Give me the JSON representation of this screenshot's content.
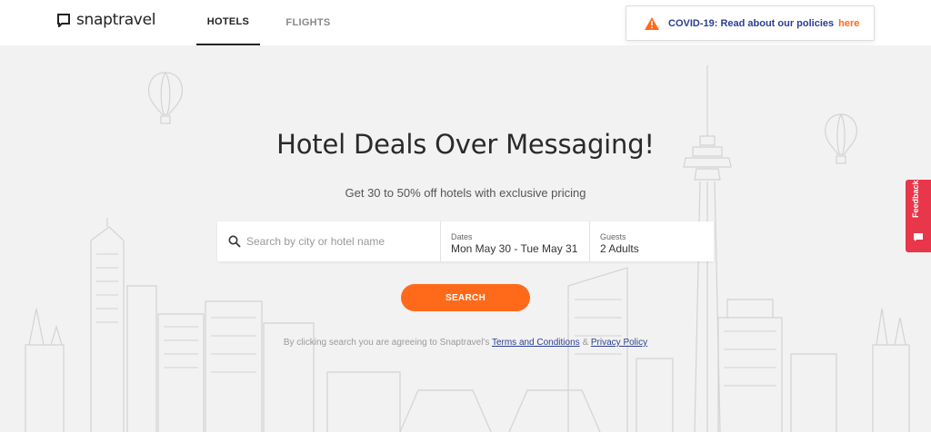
{
  "header": {
    "logo_text": "snaptravel",
    "tabs": [
      {
        "label": "HOTELS",
        "active": true
      },
      {
        "label": "FLIGHTS",
        "active": false
      }
    ]
  },
  "covid_banner": {
    "message": "COVID-19: Read about our policies",
    "link": "here",
    "icon": "warning-icon"
  },
  "hero": {
    "title": "Hotel Deals Over Messaging!",
    "subtitle": "Get 30 to 50% off hotels with exclusive pricing"
  },
  "search": {
    "placeholder": "Search by city or hotel name",
    "value": "",
    "dates_label": "Dates",
    "dates_value": "Mon May 30 - Tue May 31",
    "guests_label": "Guests",
    "guests_value": "2 Adults",
    "button_label": "SEARCH"
  },
  "legal": {
    "prefix": "By clicking search you are agreeing to Snaptravel's",
    "terms": "Terms and Conditions",
    "amp": "&",
    "privacy": "Privacy Policy"
  },
  "feedback": {
    "label": "Feedback"
  },
  "colors": {
    "accent": "#ff6a1a",
    "link": "#2a3f8f",
    "feedback": "#e8364a",
    "background": "#f2f2f2"
  }
}
